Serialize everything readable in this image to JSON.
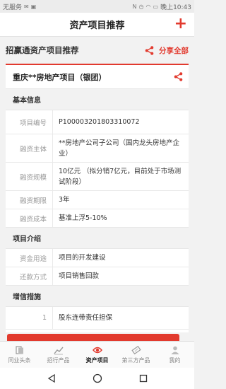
{
  "statusbar": {
    "carrier": "无服务",
    "time": "晚上10:43"
  },
  "navbar": {
    "title": "资产项目推荐",
    "plus_label": "+"
  },
  "subhead": {
    "title": "招赢通资产项目推荐",
    "share_all": "分享全部"
  },
  "card": {
    "title": "重庆**房地产项目（银团）",
    "sections": {
      "basic": "基本信息",
      "intro": "项目介绍",
      "credit": "增信措施"
    },
    "basic_rows": [
      {
        "label": "项目编号",
        "value": "P100003201803310072"
      },
      {
        "label": "融资主体",
        "value": "**房地产公司子公司（国内龙头房地产企业）"
      },
      {
        "label": "融资规模",
        "value": "10亿元 （拟分销7亿元，目前处于市场测试阶段）"
      },
      {
        "label": "融资期限",
        "value": "3年"
      },
      {
        "label": "融资成本",
        "value": "基准上浮5-10%"
      }
    ],
    "intro_rows": [
      {
        "label": "资金用途",
        "value": "项目的开发建设"
      },
      {
        "label": "还款方式",
        "value": "项目销售回款"
      }
    ],
    "credit_rows": [
      {
        "label": "1",
        "value": "股东连带责任担保"
      }
    ]
  },
  "tabs": [
    {
      "label": "同业头条",
      "icon": "book-icon"
    },
    {
      "label": "招行产品",
      "icon": "trend-icon"
    },
    {
      "label": "资产项目",
      "icon": "eye-icon"
    },
    {
      "label": "第三方产品",
      "icon": "ticket-icon"
    },
    {
      "label": "我的",
      "icon": "person-icon"
    }
  ],
  "colors": {
    "accent": "#e23a2e"
  }
}
